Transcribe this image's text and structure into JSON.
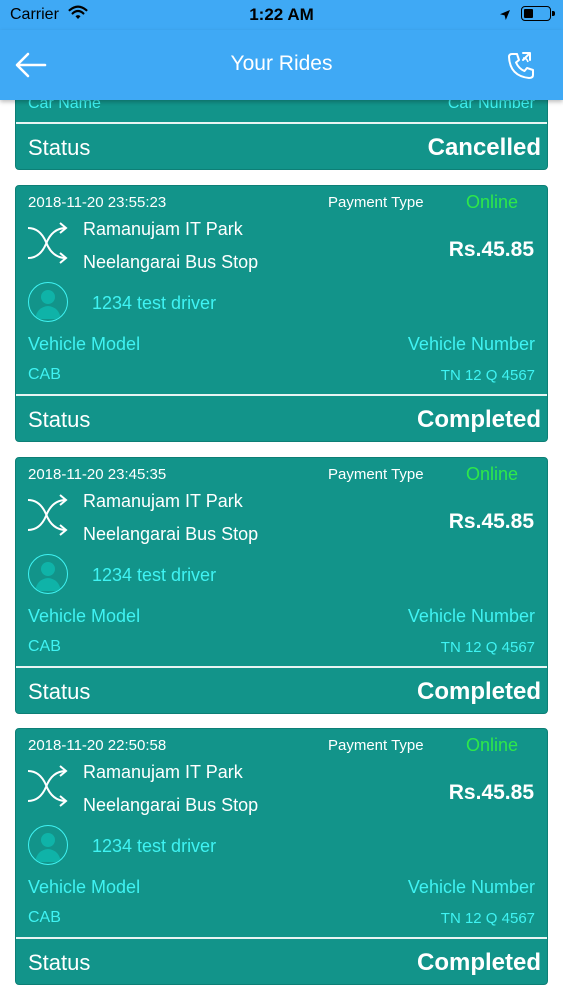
{
  "status_bar": {
    "carrier": "Carrier",
    "time": "1:22 AM",
    "icons": [
      "wifi-icon",
      "location-arrow-icon",
      "battery-icon"
    ]
  },
  "header": {
    "title": "Your Rides",
    "back_icon": "arrow-left-icon",
    "call_icon": "phone-call-icon",
    "background_color": "#3fa9f5"
  },
  "colors": {
    "card": "#12948a",
    "accent_cyan": "#3ff3f3",
    "online_green": "#2ee84a"
  },
  "partial_ride": {
    "car_name_label": "Car Name",
    "car_number_label": "Car Number",
    "status_label": "Status",
    "status": "Cancelled"
  },
  "rides": [
    {
      "datetime": "2018-11-20 23:55:23",
      "payment_type_label": "Payment Type",
      "payment_type": "Online",
      "pickup": "Ramanujam IT Park",
      "drop": "Neelangarai Bus Stop",
      "amount": "Rs.45.85",
      "driver": "1234 test driver",
      "vehicle_model_label": "Vehicle Model",
      "vehicle_number_label": "Vehicle Number",
      "vehicle_model": "CAB",
      "vehicle_number": "TN 12 Q 4567",
      "status_label": "Status",
      "status": "Completed"
    },
    {
      "datetime": "2018-11-20 23:45:35",
      "payment_type_label": "Payment Type",
      "payment_type": "Online",
      "pickup": "Ramanujam IT Park",
      "drop": "Neelangarai Bus Stop",
      "amount": "Rs.45.85",
      "driver": "1234 test driver",
      "vehicle_model_label": "Vehicle Model",
      "vehicle_number_label": "Vehicle Number",
      "vehicle_model": "CAB",
      "vehicle_number": "TN 12 Q 4567",
      "status_label": "Status",
      "status": "Completed"
    },
    {
      "datetime": "2018-11-20 22:50:58",
      "payment_type_label": "Payment Type",
      "payment_type": "Online",
      "pickup": "Ramanujam IT Park",
      "drop": "Neelangarai Bus Stop",
      "amount": "Rs.45.85",
      "driver": "1234 test driver",
      "vehicle_model_label": "Vehicle Model",
      "vehicle_number_label": "Vehicle Number",
      "vehicle_model": "CAB",
      "vehicle_number": "TN 12 Q 4567",
      "status_label": "Status",
      "status": "Completed"
    }
  ]
}
